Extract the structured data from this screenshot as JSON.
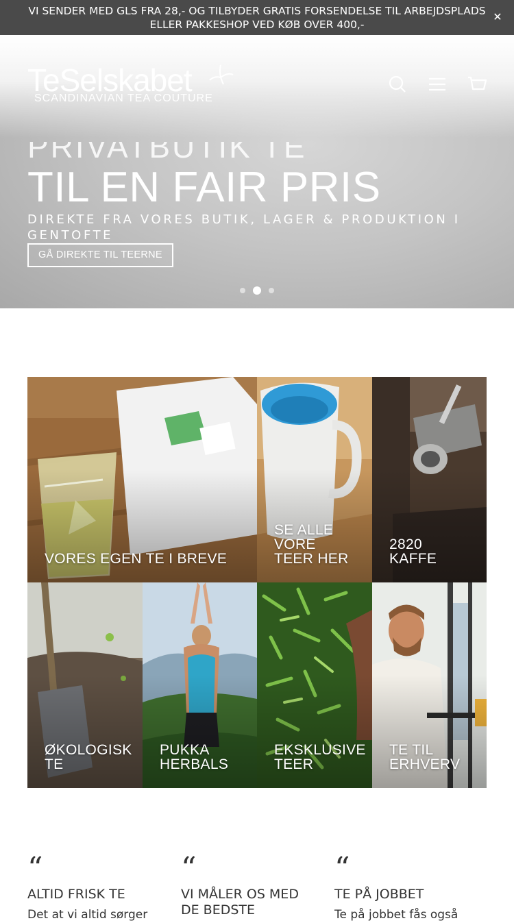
{
  "announcement": {
    "text": "VI SENDER MED GLS FRA 28,- OG TILBYDER GRATIS FORSENDELSE TIL ARBEJDSPLADS ELLER PAKKESHOP VED KØB OVER 400,-",
    "close": "✕"
  },
  "header": {
    "logo_word": "TeSelskabet",
    "logo_tagline": "SCANDINAVIAN TEA COUTURE",
    "icons": [
      "search-icon",
      "menu-icon",
      "cart-icon"
    ]
  },
  "hero": {
    "ghost_line": "PRIVATBUTIK TE",
    "title": "TIL EN FAIR PRIS",
    "subtitle": "DIREKTE FRA VORES BUTIK, LAGER & PRODUKTION I GENTOFTE",
    "button": "GÅ DIREKTE TIL TEERNE",
    "slides": 3,
    "active_slide": 2
  },
  "tiles": [
    {
      "label": "VORES EGEN TE I BREVE"
    },
    {
      "label": "SE ALLE\nVORE\nTEER HER"
    },
    {
      "label": "2820\nKAFFE"
    },
    {
      "label": "ØKOLOGISK\nTE"
    },
    {
      "label": "PUKKA\nHERBALS"
    },
    {
      "label": "EKSKLUSIVE\nTEER"
    },
    {
      "label": "TE TIL\nERHVERV"
    }
  ],
  "quotes": [
    {
      "mark": "“",
      "title": "ALTID FRISK TE",
      "body": "Det at vi altid sørger"
    },
    {
      "mark": "“",
      "title": "VI MÅLER OS MED DE BEDSTE",
      "body": ""
    },
    {
      "mark": "“",
      "title": "TE PÅ JOBBET",
      "body": "Te på jobbet fås også"
    }
  ],
  "colors": {
    "announcement_bg": "#4a4a4a",
    "text_dark": "#333333",
    "hero_text": "#ffffff"
  }
}
